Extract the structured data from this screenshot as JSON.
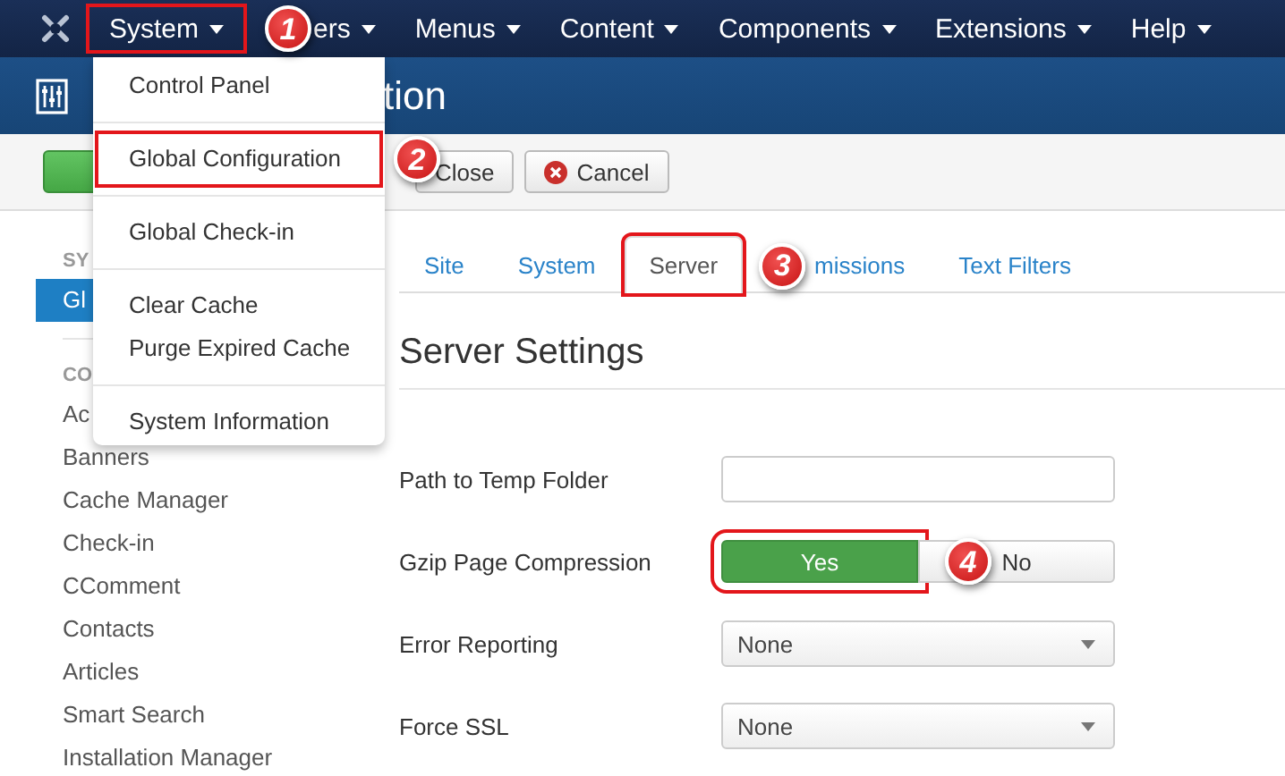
{
  "navbar": {
    "items": [
      {
        "label": "System",
        "highlighted": true,
        "step": "1"
      },
      {
        "label": "ers",
        "highlighted": false
      },
      {
        "label": "Menus",
        "highlighted": false
      },
      {
        "label": "Content",
        "highlighted": false
      },
      {
        "label": "Components",
        "highlighted": false
      },
      {
        "label": "Extensions",
        "highlighted": false
      },
      {
        "label": "Help",
        "highlighted": false
      }
    ]
  },
  "header": {
    "title": "tion"
  },
  "toolbar": {
    "buttons": [
      {
        "kind": "save"
      },
      {
        "kind": "default",
        "label": "Close"
      },
      {
        "kind": "cancel",
        "label": "Cancel"
      }
    ]
  },
  "sidebar": {
    "sections": [
      {
        "heading": "SY",
        "items": [
          {
            "label": "Gl",
            "selected": true
          }
        ]
      },
      {
        "heading": "CO",
        "items": [
          {
            "label": "Ac",
            "selected": false
          },
          {
            "label": "Banners",
            "selected": false
          },
          {
            "label": "Cache Manager",
            "selected": false
          },
          {
            "label": "Check-in",
            "selected": false
          },
          {
            "label": "CComment",
            "selected": false
          },
          {
            "label": "Contacts",
            "selected": false
          },
          {
            "label": "Articles",
            "selected": false
          },
          {
            "label": "Smart Search",
            "selected": false
          },
          {
            "label": "Installation Manager",
            "selected": false
          }
        ]
      }
    ]
  },
  "tabs": [
    {
      "label": "Site",
      "selected": false,
      "highlighted": false
    },
    {
      "label": "System",
      "selected": false,
      "highlighted": false
    },
    {
      "label": "Server",
      "selected": true,
      "highlighted": true,
      "step": "3"
    },
    {
      "label": "missions",
      "selected": false,
      "highlighted": false
    },
    {
      "label": "Text Filters",
      "selected": false,
      "highlighted": false
    }
  ],
  "settings": {
    "title": "Server Settings",
    "fields": [
      {
        "kind": "text",
        "label": "Path to Temp Folder"
      },
      {
        "kind": "toggle",
        "label": "Gzip Page Compression",
        "options": [
          {
            "label": "Yes",
            "selected": true,
            "highlighted": true,
            "step": "4"
          },
          {
            "label": "No",
            "selected": false,
            "highlighted": false
          }
        ]
      },
      {
        "kind": "select",
        "label": "Error Reporting",
        "value": "None"
      },
      {
        "kind": "select",
        "label": "Force SSL",
        "value": "None"
      }
    ]
  },
  "menu": {
    "groups": [
      [
        {
          "label": "Control Panel",
          "highlighted": false
        }
      ],
      [
        {
          "label": "Global Configuration",
          "highlighted": true,
          "step": "2"
        }
      ],
      [
        {
          "label": "Global Check-in",
          "highlighted": false
        }
      ],
      [
        {
          "label": "Clear Cache",
          "highlighted": false
        },
        {
          "label": "Purge Expired Cache",
          "highlighted": false
        }
      ],
      [
        {
          "label": "System Information",
          "highlighted": false
        }
      ]
    ]
  }
}
